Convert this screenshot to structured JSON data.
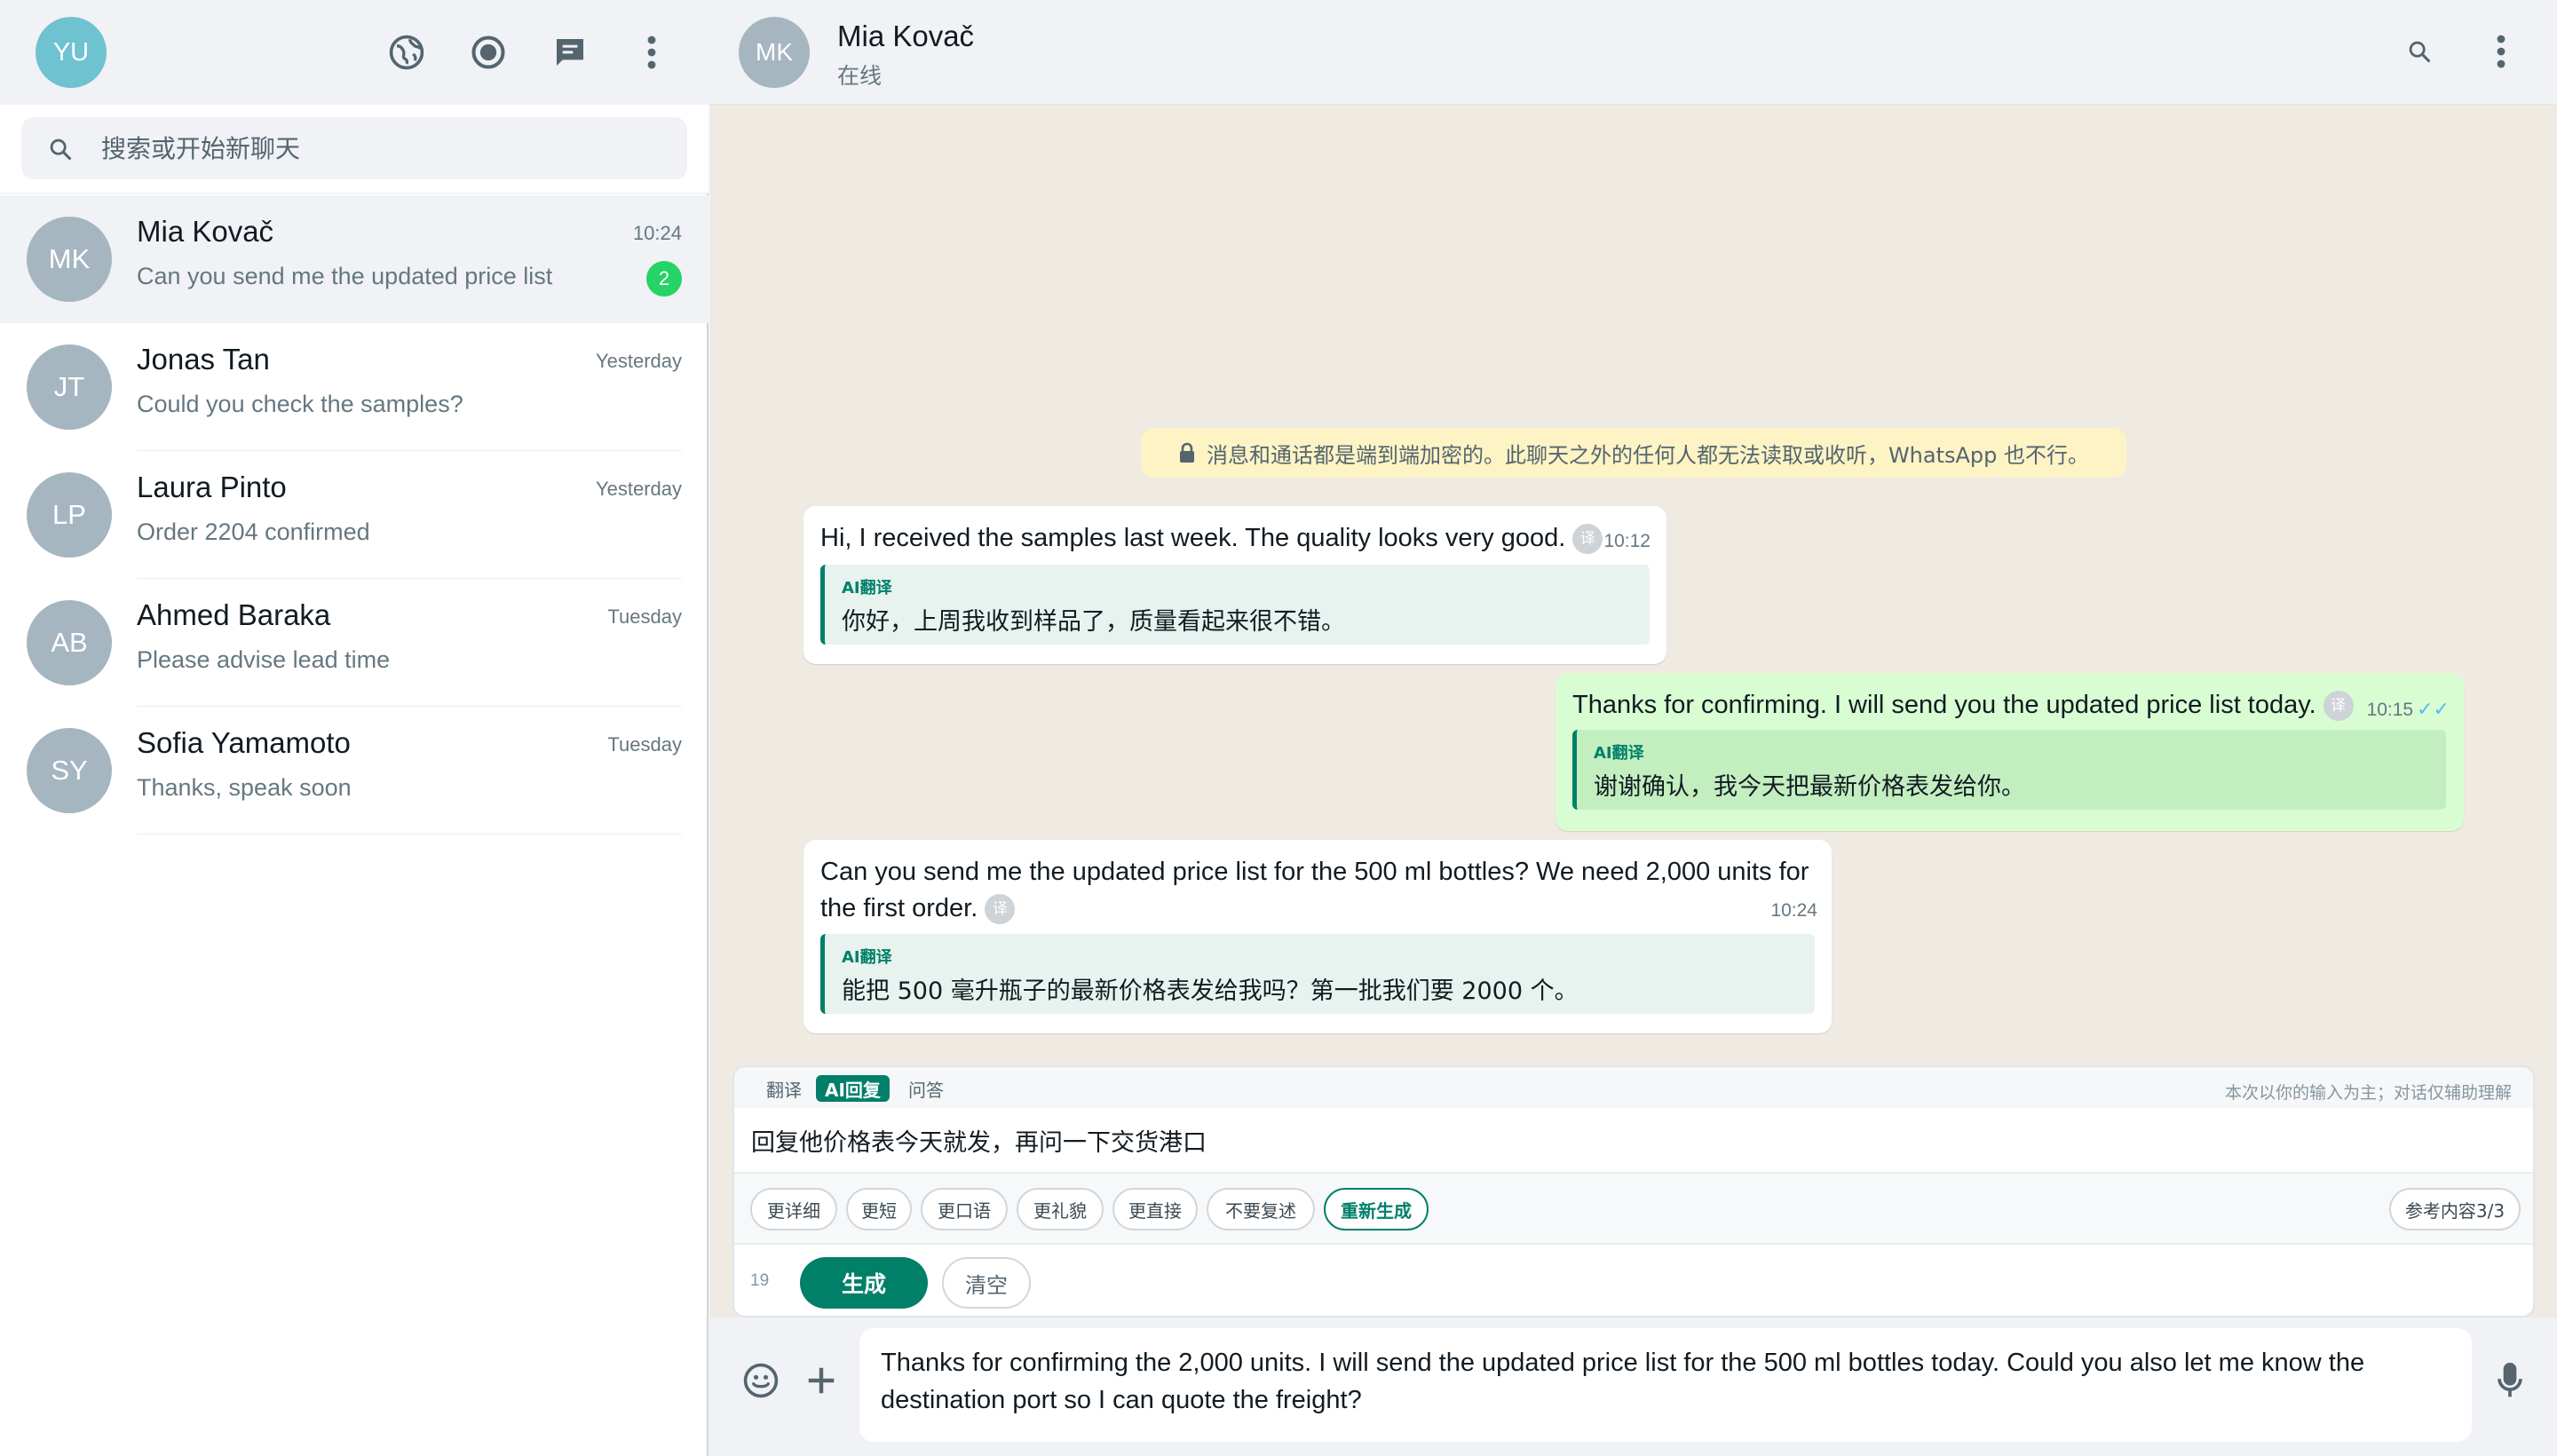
{
  "sidebar": {
    "my_avatar": "YU",
    "icons": [
      "community-icon",
      "status-icon",
      "new-chat-icon",
      "menu-icon"
    ],
    "search_placeholder": "搜索或开始新聊天",
    "chats": [
      {
        "initials": "MK",
        "name": "Mia Kovač",
        "preview": "Can you send me the updated price list",
        "time": "10:24",
        "unread": "2",
        "active": true
      },
      {
        "initials": "JT",
        "name": "Jonas Tan",
        "preview": "Could you check the samples?",
        "time": "Yesterday"
      },
      {
        "initials": "LP",
        "name": "Laura Pinto",
        "preview": "Order 2204 confirmed",
        "time": "Yesterday"
      },
      {
        "initials": "AB",
        "name": "Ahmed Baraka",
        "preview": "Please advise lead time",
        "time": "Tuesday"
      },
      {
        "initials": "SY",
        "name": "Sofia Yamamoto",
        "preview": "Thanks, speak soon",
        "time": "Tuesday"
      }
    ]
  },
  "header": {
    "initials": "MK",
    "name": "Mia Kovač",
    "status": "在线"
  },
  "notice": "消息和通话都是端到端加密的。此聊天之外的任何人都无法读取或收听，WhatsApp 也不行。",
  "messages": [
    {
      "direction": "in",
      "text": "Hi, I received the samples last week. The quality looks very good.",
      "translate_button": "译",
      "time": "10:12",
      "ai_label": "AI翻译",
      "translation": "你好，上周我收到样品了，质量看起来很不错。"
    },
    {
      "direction": "out",
      "text": "Thanks for confirming. I will send you the updated price list today.",
      "translate_button": "译",
      "time": "10:15",
      "ticks": "✓✓",
      "ai_label": "AI翻译",
      "translation": "谢谢确认，我今天把最新价格表发给你。"
    },
    {
      "direction": "in",
      "text_line1": "Can you send me the updated price list for the 500 ml bottles? We need 2,000 units for",
      "text_line2": "the first order.",
      "translate_button": "译",
      "time": "10:24",
      "ai_label": "AI翻译",
      "translation": "能把 500 毫升瓶子的最新价格表发给我吗？第一批我们要 2000 个。"
    }
  ],
  "ai_panel": {
    "tabs": [
      "翻译",
      "AI回复",
      "问答"
    ],
    "active_tab": "AI回复",
    "hint": "本次以你的输入为主；对话仅辅助理解",
    "prompt_value": "回复他价格表今天就发，再问一下交货港口",
    "chips": [
      "更详细",
      "更短",
      "更口语",
      "更礼貌",
      "更直接",
      "不要复述",
      "重新生成"
    ],
    "reference_chip": "参考内容3/3",
    "char_count": "19",
    "generate_label": "生成",
    "clear_label": "清空"
  },
  "composer": {
    "text_line1": "Thanks for confirming the 2,000 units. I will send the updated price list for the 500 ml bottles today. Could you also let me know the",
    "text_line2": "destination port so I can quote the freight?"
  },
  "colors": {
    "accent": "#008069",
    "unread_badge": "#25d366",
    "outgoing_bubble": "#d9fdd3",
    "incoming_bubble": "#ffffff",
    "chat_background": "#efeae2",
    "read_ticks": "#53bdeb"
  }
}
